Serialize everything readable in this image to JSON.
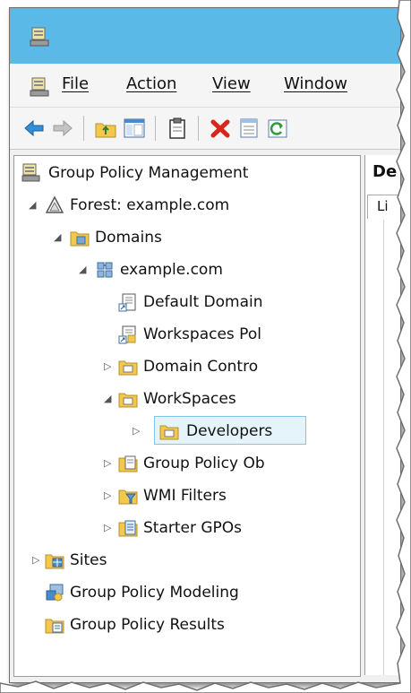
{
  "menu": {
    "file": "File",
    "action": "Action",
    "view": "View",
    "window": "Window"
  },
  "right_pane": {
    "title": "De",
    "tab": "Li"
  },
  "tree": {
    "root": "Group Policy Management",
    "forest": "Forest: example.com",
    "domains": "Domains",
    "domain": "example.com",
    "default_domain": "Default Domain",
    "workspaces_pol": "Workspaces Pol",
    "domain_controllers": "Domain Contro",
    "workspaces": "WorkSpaces",
    "developers": "Developers",
    "gpo": "Group Policy Ob",
    "wmi": "WMI Filters",
    "starter": "Starter GPOs",
    "sites": "Sites",
    "modeling": "Group Policy Modeling",
    "results": "Group Policy Results"
  },
  "colors": {
    "titlebar": "#5ab9e6",
    "selection_bg": "#e5f3fb",
    "selection_border": "#7fc4e8"
  }
}
